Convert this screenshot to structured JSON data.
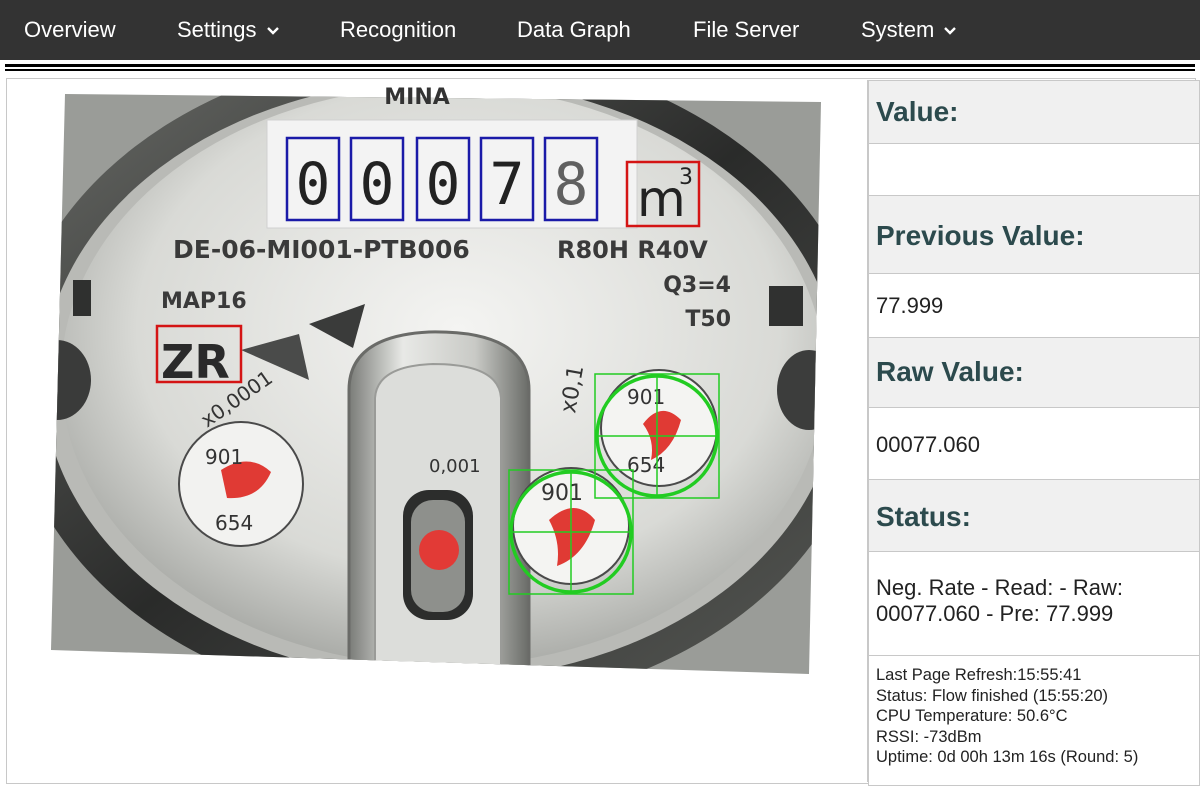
{
  "nav": {
    "items": [
      {
        "label": "Overview",
        "dropdown": false
      },
      {
        "label": "Settings",
        "dropdown": true
      },
      {
        "label": "Recognition",
        "dropdown": false
      },
      {
        "label": "Data Graph",
        "dropdown": false
      },
      {
        "label": "File Server",
        "dropdown": false
      },
      {
        "label": "System",
        "dropdown": true
      }
    ]
  },
  "meter_image": {
    "digits": [
      "0",
      "0",
      "0",
      "7",
      "8"
    ],
    "unit": "m",
    "unit_superscript": "3",
    "labels": {
      "brand": "MINA",
      "model": "DE-06-MI001-PTB006",
      "spec1": "R80H R40V",
      "spec2": "Q3=4",
      "spec3": "T50",
      "map": "MAP16",
      "zr": "ZR",
      "dial_small": "x0,0001",
      "dial_center": "0,001",
      "dial_right": "x0,1"
    }
  },
  "panel": {
    "value_title": "Value:",
    "value": "",
    "previous_title": "Previous Value:",
    "previous_value": "77.999",
    "raw_title": "Raw Value:",
    "raw_value": "00077.060",
    "status_title": "Status:",
    "status_value": "Neg. Rate - Read: - Raw: 00077.060 - Pre: 77.999",
    "info": {
      "last_refresh": "Last Page Refresh:15:55:41",
      "status": "Status: Flow finished (15:55:20)",
      "cpu_temp": "CPU Temperature: 50.6°C",
      "rssi": "RSSI: -73dBm",
      "uptime": "Uptime: 0d 00h 13m 16s (Round: 5)"
    }
  },
  "colors": {
    "navbar": "#333333",
    "header_bg": "#f0f0f0",
    "header_text": "#2c4a4d",
    "digit_box": "#1a1aa8",
    "unit_box": "#d41414",
    "dial_roi": "#22cc22"
  }
}
